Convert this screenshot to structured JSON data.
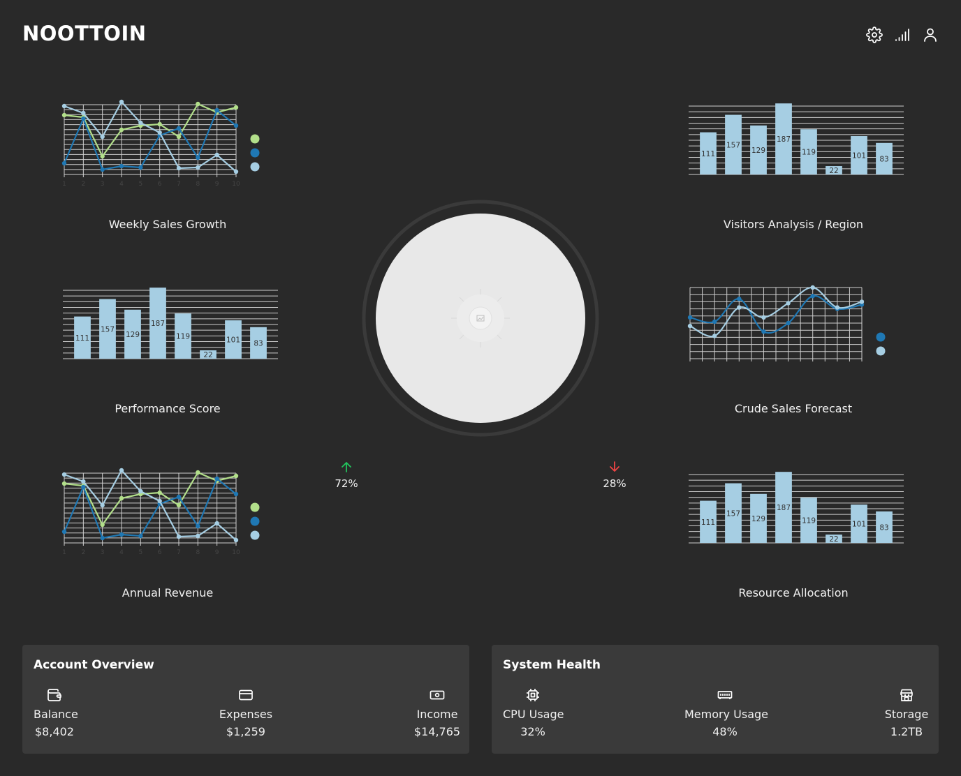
{
  "app": {
    "title": "NOOTTOIN"
  },
  "header": {
    "icons": [
      "gear-icon",
      "signal-icon",
      "user-icon"
    ]
  },
  "colors": {
    "background": "#292929",
    "panel": "#3a3a3a",
    "green_series": "#b2df8a",
    "dark_blue_series": "#1f78b4",
    "light_blue_series": "#a6cee3",
    "grid": "#c8c8c8",
    "up_arrow": "#22c55e",
    "down_arrow": "#ef4444"
  },
  "charts": {
    "weekly_sales": {
      "title": "Weekly Sales Growth"
    },
    "visitors": {
      "title": "Visitors Analysis / Region"
    },
    "performance": {
      "title": "Performance Score"
    },
    "crude_forecast": {
      "title": "Crude Sales Forecast"
    },
    "annual_revenue": {
      "title": "Annual Revenue"
    },
    "resource_allocation": {
      "title": "Resource Allocation"
    }
  },
  "chart_data": [
    {
      "id": "weekly_sales",
      "type": "line",
      "title": "Weekly Sales Growth",
      "x": [
        1,
        2,
        3,
        4,
        5,
        6,
        7,
        8,
        9,
        10
      ],
      "xlabel": "",
      "ylabel": "",
      "ylim": [
        0,
        100
      ],
      "grid": true,
      "legend": "right",
      "series": [
        {
          "name": "",
          "color": "#b2df8a",
          "values": [
            85,
            82,
            26,
            64,
            70,
            72,
            54,
            101,
            89,
            96
          ]
        },
        {
          "name": "",
          "color": "#1f78b4",
          "values": [
            16,
            80,
            7,
            12,
            10,
            56,
            66,
            24,
            92,
            70
          ]
        },
        {
          "name": "",
          "color": "#a6cee3",
          "values": [
            98,
            88,
            54,
            104,
            74,
            60,
            9,
            10,
            28,
            4
          ]
        }
      ]
    },
    {
      "id": "visitors",
      "type": "bar",
      "title": "Visitors Analysis / Region",
      "categories": [
        "",
        "",
        "",
        "",
        "",
        "",
        "",
        ""
      ],
      "values": [
        111,
        157,
        129,
        187,
        119,
        22,
        101,
        83
      ],
      "xlabel": "",
      "ylabel": "",
      "ylim": [
        0,
        180
      ],
      "grid": true
    },
    {
      "id": "performance",
      "type": "bar",
      "title": "Performance Score",
      "categories": [
        "",
        "",
        "",
        "",
        "",
        "",
        "",
        ""
      ],
      "values": [
        111,
        157,
        129,
        187,
        119,
        22,
        101,
        83
      ],
      "xlabel": "",
      "ylabel": "",
      "ylim": [
        0,
        180
      ],
      "grid": true
    },
    {
      "id": "crude_forecast",
      "type": "line",
      "title": "Crude Sales Forecast",
      "x": [
        "",
        "",
        "",
        "",
        "",
        "",
        "",
        "",
        "",
        "",
        "",
        "",
        "",
        "",
        ""
      ],
      "xlabel": "",
      "ylabel": "",
      "ylim": [
        0,
        100
      ],
      "grid": true,
      "legend": "right",
      "series": [
        {
          "name": "",
          "color": "#1f78b4",
          "values": [
            58,
            52,
            84,
            38,
            50,
            88,
            70,
            76
          ]
        },
        {
          "name": "",
          "color": "#a6cee3",
          "values": [
            46,
            32,
            72,
            58,
            78,
            100,
            72,
            80
          ]
        }
      ]
    },
    {
      "id": "annual_revenue",
      "type": "line",
      "title": "Annual Revenue",
      "x": [
        1,
        2,
        3,
        4,
        5,
        6,
        7,
        8,
        9,
        10
      ],
      "xlabel": "",
      "ylabel": "",
      "ylim": [
        0,
        100
      ],
      "grid": true,
      "legend": "right",
      "series": [
        {
          "name": "",
          "color": "#b2df8a",
          "values": [
            85,
            82,
            26,
            64,
            70,
            72,
            54,
            101,
            89,
            96
          ]
        },
        {
          "name": "",
          "color": "#1f78b4",
          "values": [
            16,
            80,
            7,
            12,
            10,
            56,
            66,
            24,
            92,
            70
          ]
        },
        {
          "name": "",
          "color": "#a6cee3",
          "values": [
            98,
            88,
            54,
            104,
            74,
            60,
            9,
            10,
            28,
            4
          ]
        }
      ]
    },
    {
      "id": "resource_allocation",
      "type": "bar",
      "title": "Resource Allocation",
      "categories": [
        "",
        "",
        "",
        "",
        "",
        "",
        "",
        ""
      ],
      "values": [
        111,
        157,
        129,
        187,
        119,
        22,
        101,
        83
      ],
      "xlabel": "",
      "ylabel": "",
      "ylim": [
        0,
        180
      ],
      "grid": true
    }
  ],
  "gauge": {
    "image_icon": "image-placeholder-icon",
    "up": {
      "value": "72%",
      "icon": "arrow-up-icon"
    },
    "down": {
      "value": "28%",
      "icon": "arrow-down-icon"
    }
  },
  "account": {
    "title": "Account Overview",
    "items": [
      {
        "label": "Balance",
        "value": "$8,402",
        "icon": "wallet-icon"
      },
      {
        "label": "Expenses",
        "value": "$1,259",
        "icon": "credit-card-icon"
      },
      {
        "label": "Income",
        "value": "$14,765",
        "icon": "cash-icon"
      }
    ]
  },
  "system": {
    "title": "System Health",
    "items": [
      {
        "label": "CPU Usage",
        "value": "32%",
        "icon": "cpu-icon"
      },
      {
        "label": "Memory Usage",
        "value": "48%",
        "icon": "memory-icon"
      },
      {
        "label": "Storage",
        "value": "1.2TB",
        "icon": "storage-icon"
      }
    ]
  }
}
